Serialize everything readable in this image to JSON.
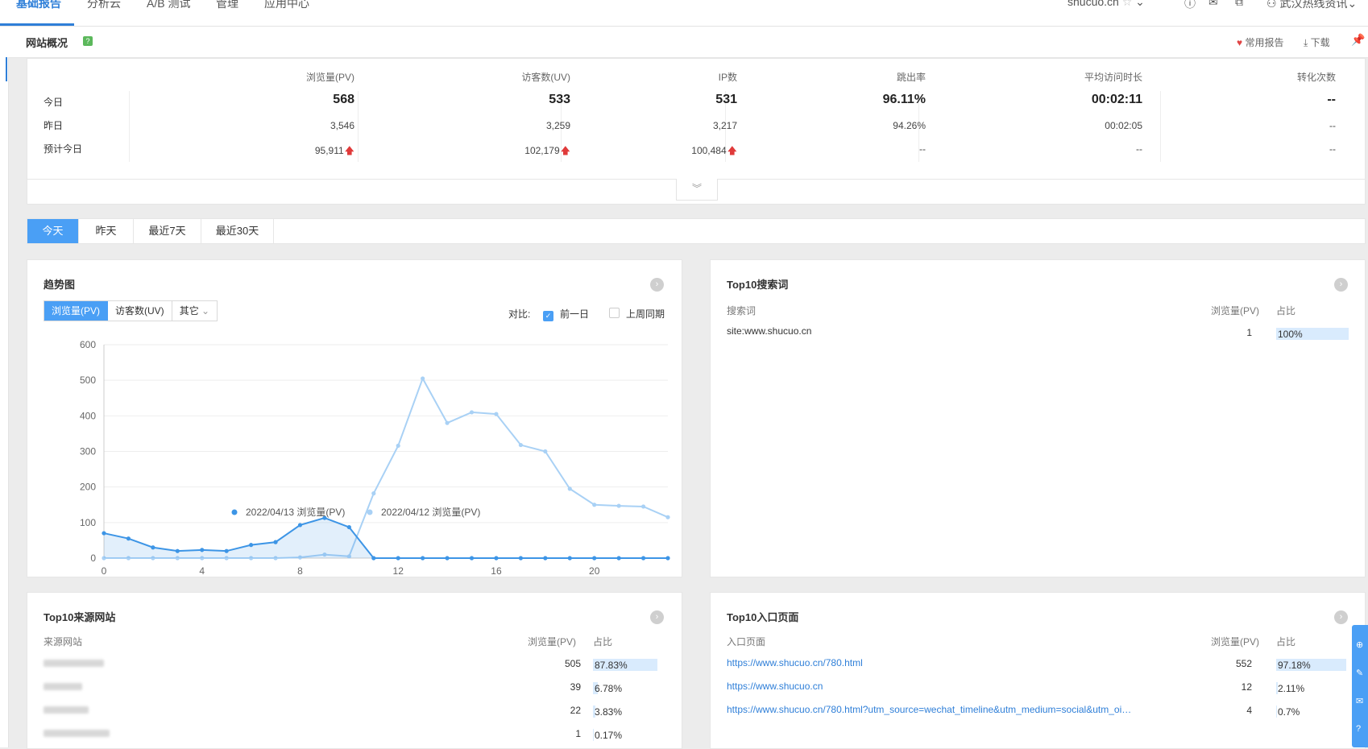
{
  "top_nav": {
    "tabs": [
      "基础报告",
      "分析云",
      "A/B 测试",
      "管理",
      "应用中心"
    ],
    "site": "shucuo.cn",
    "user": "武汉热线资讯"
  },
  "sub_header": {
    "title": "网站概况",
    "help": "?",
    "favorite_label": "常用报告",
    "download_label": "下载"
  },
  "summary": {
    "columns": [
      "浏览量(PV)",
      "访客数(UV)",
      "IP数",
      "跳出率",
      "平均访问时长",
      "转化次数"
    ],
    "rows": [
      {
        "label": "今日",
        "values": [
          "568",
          "533",
          "531",
          "96.11%",
          "00:02:11",
          "--"
        ]
      },
      {
        "label": "昨日",
        "values": [
          "3,546",
          "3,259",
          "3,217",
          "94.26%",
          "00:02:05",
          "--"
        ]
      },
      {
        "label": "预计今日",
        "values": [
          "95,911",
          "102,179",
          "100,484",
          "--",
          "--",
          "--"
        ]
      }
    ],
    "up_arrow": "🡅",
    "expand_icon": "︾"
  },
  "range_tabs": [
    "今天",
    "昨天",
    "最近7天",
    "最近30天"
  ],
  "trend": {
    "title": "趋势图",
    "metric_tabs": [
      "浏览量(PV)",
      "访客数(UV)",
      "其它"
    ],
    "compare_label": "对比:",
    "compare_prev_day": "前一日",
    "compare_last_week": "上周同期"
  },
  "chart_data": {
    "type": "line",
    "x": [
      0,
      1,
      2,
      3,
      4,
      5,
      6,
      7,
      8,
      9,
      10,
      11,
      12,
      13,
      14,
      15,
      16,
      17,
      18,
      19,
      20,
      21,
      22,
      23
    ],
    "x_ticks": [
      "0",
      "4",
      "8",
      "12",
      "16",
      "20"
    ],
    "y_ticks": [
      "0",
      "100",
      "200",
      "300",
      "400",
      "500",
      "600"
    ],
    "ylim": [
      0,
      600
    ],
    "series": [
      {
        "name": "2022/04/13 浏览量(PV)",
        "color": "#3d95e6",
        "values": [
          70,
          55,
          30,
          20,
          23,
          20,
          37,
          45,
          93,
          113,
          87,
          0,
          0,
          0,
          0,
          0,
          0,
          0,
          0,
          0,
          0,
          0,
          0,
          0
        ]
      },
      {
        "name": "2022/04/12 浏览量(PV)",
        "color": "#a9d1f5",
        "values": [
          0,
          0,
          0,
          0,
          0,
          0,
          0,
          0,
          2,
          10,
          5,
          182,
          316,
          505,
          380,
          410,
          405,
          318,
          300,
          195,
          150,
          147,
          145,
          115
        ]
      }
    ],
    "grid": true,
    "legend": "bottom-center"
  },
  "search_words": {
    "title": "Top10搜索词",
    "headers": [
      "搜索词",
      "浏览量(PV)",
      "占比"
    ],
    "rows": [
      {
        "term": "site:www.shucuo.cn",
        "pv": "1",
        "pct": "100%",
        "ratio": 1.0
      }
    ]
  },
  "source_sites": {
    "title": "Top10来源网站",
    "headers": [
      "来源网站",
      "浏览量(PV)",
      "占比"
    ],
    "rows": [
      {
        "pv": "505",
        "pct": "87.83%",
        "ratio": 0.8783
      },
      {
        "pv": "39",
        "pct": "6.78%",
        "ratio": 0.0678
      },
      {
        "pv": "22",
        "pct": "3.83%",
        "ratio": 0.0383
      },
      {
        "pv": "1",
        "pct": "0.17%",
        "ratio": 0.0017
      }
    ]
  },
  "entry_pages": {
    "title": "Top10入口页面",
    "headers": [
      "入口页面",
      "浏览量(PV)",
      "占比"
    ],
    "rows": [
      {
        "url": "https://www.shucuo.cn/780.html",
        "pv": "552",
        "pct": "97.18%",
        "ratio": 0.9718
      },
      {
        "url": "https://www.shucuo.cn",
        "pv": "12",
        "pct": "2.11%",
        "ratio": 0.0211
      },
      {
        "url": "https://www.shucuo.cn/780.html?utm_source=wechat_timeline&utm_medium=social&utm_oi…",
        "pv": "4",
        "pct": "0.7%",
        "ratio": 0.007
      }
    ]
  }
}
